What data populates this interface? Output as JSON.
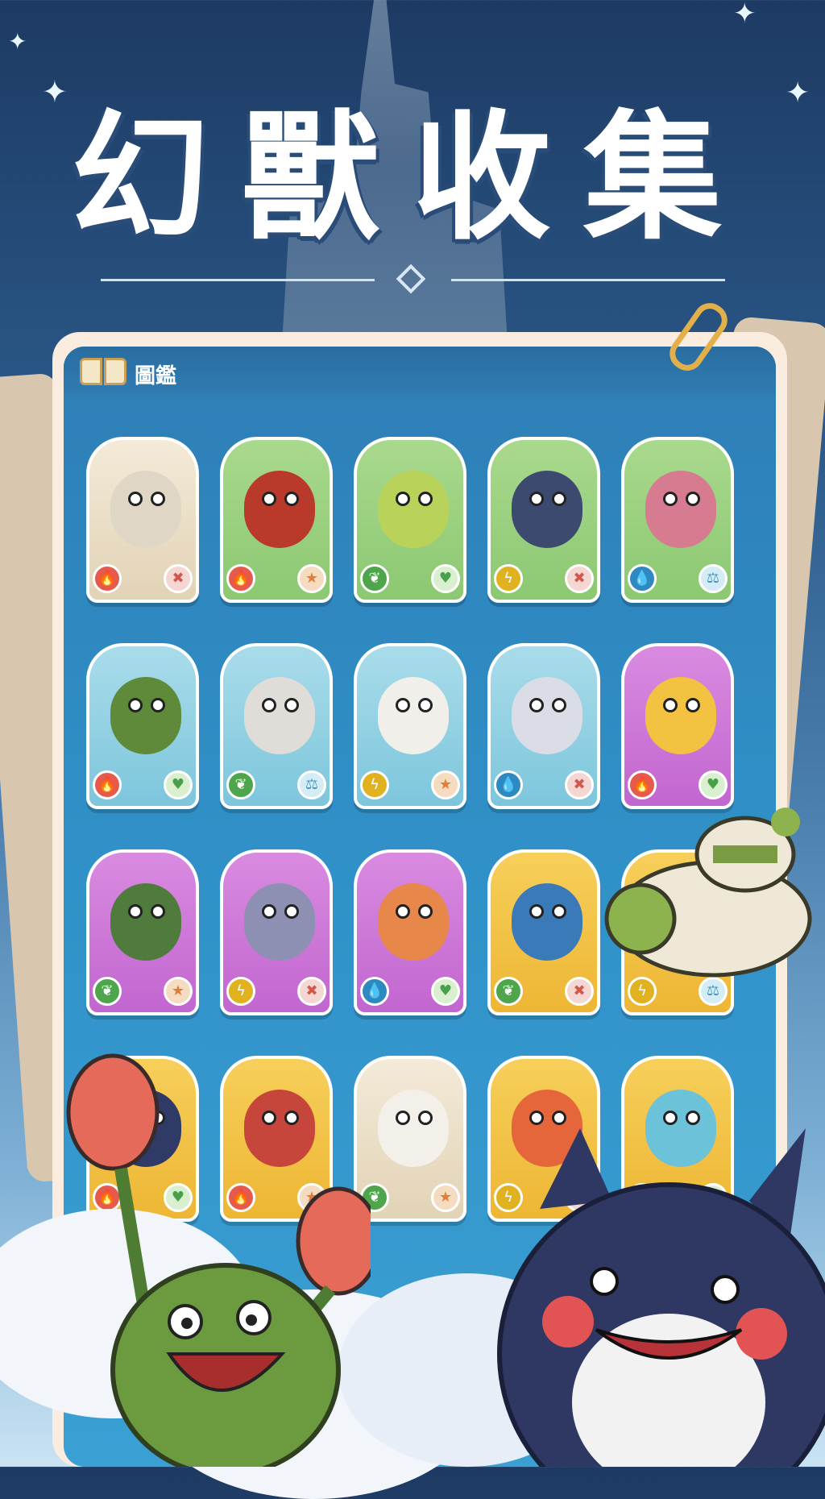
{
  "title": "幻獸收集",
  "panel": {
    "header_title": "圖鑑"
  },
  "cards": [
    {
      "bg": "cream",
      "creature_color": "#e0d6c6",
      "type_icon": "flame-icon",
      "type_glyph": "🔥",
      "type_class": "type-fire",
      "status_icon": "cross-icon",
      "status_glyph": "✖",
      "status_class": "st-cross"
    },
    {
      "bg": "green",
      "creature_color": "#b93a2a",
      "type_icon": "flame-icon",
      "type_glyph": "🔥",
      "type_class": "type-fire",
      "status_icon": "star-icon",
      "status_glyph": "★",
      "status_class": "st-star"
    },
    {
      "bg": "green",
      "creature_color": "#b9d35a",
      "type_icon": "leaf-icon",
      "type_glyph": "❦",
      "type_class": "type-leaf",
      "status_icon": "heart-icon",
      "status_glyph": "♥",
      "status_class": "st-heart"
    },
    {
      "bg": "green",
      "creature_color": "#3d4a70",
      "type_icon": "bolt-icon",
      "type_glyph": "ϟ",
      "type_class": "type-bolt",
      "status_icon": "cross-icon",
      "status_glyph": "✖",
      "status_class": "st-cross"
    },
    {
      "bg": "green",
      "creature_color": "#d77b90",
      "type_icon": "water-drop-icon",
      "type_glyph": "💧",
      "type_class": "type-water",
      "status_icon": "scale-icon",
      "status_glyph": "⚖",
      "status_class": "st-scale"
    },
    {
      "bg": "blue",
      "creature_color": "#5e8a3a",
      "type_icon": "flame-icon",
      "type_glyph": "🔥",
      "type_class": "type-fire",
      "status_icon": "heart-icon",
      "status_glyph": "♥",
      "status_class": "st-heart"
    },
    {
      "bg": "blue",
      "creature_color": "#e0ddd8",
      "type_icon": "leaf-icon",
      "type_glyph": "❦",
      "type_class": "type-leaf",
      "status_icon": "scale-icon",
      "status_glyph": "⚖",
      "status_class": "st-scale"
    },
    {
      "bg": "blue",
      "creature_color": "#f0efe9",
      "type_icon": "bolt-icon",
      "type_glyph": "ϟ",
      "type_class": "type-bolt",
      "status_icon": "star-icon",
      "status_glyph": "★",
      "status_class": "st-star"
    },
    {
      "bg": "blue",
      "creature_color": "#dadde6",
      "type_icon": "water-drop-icon",
      "type_glyph": "💧",
      "type_class": "type-water",
      "status_icon": "cross-icon",
      "status_glyph": "✖",
      "status_class": "st-cross"
    },
    {
      "bg": "purple",
      "creature_color": "#f2c240",
      "type_icon": "flame-icon",
      "type_glyph": "🔥",
      "type_class": "type-fire",
      "status_icon": "heart-icon",
      "status_glyph": "♥",
      "status_class": "st-heart"
    },
    {
      "bg": "purple",
      "creature_color": "#4f7b3c",
      "type_icon": "leaf-icon",
      "type_glyph": "❦",
      "type_class": "type-leaf",
      "status_icon": "star-icon",
      "status_glyph": "★",
      "status_class": "st-star"
    },
    {
      "bg": "purple",
      "creature_color": "#8d90b3",
      "type_icon": "bolt-icon",
      "type_glyph": "ϟ",
      "type_class": "type-bolt",
      "status_icon": "cross-icon",
      "status_glyph": "✖",
      "status_class": "st-cross"
    },
    {
      "bg": "purple",
      "creature_color": "#e7874a",
      "type_icon": "water-drop-icon",
      "type_glyph": "💧",
      "type_class": "type-water",
      "status_icon": "heart-icon",
      "status_glyph": "♥",
      "status_class": "st-heart"
    },
    {
      "bg": "yellow",
      "creature_color": "#3a7ab8",
      "type_icon": "leaf-icon",
      "type_glyph": "❦",
      "type_class": "type-leaf",
      "status_icon": "cross-icon",
      "status_glyph": "✖",
      "status_class": "st-cross"
    },
    {
      "bg": "yellow",
      "creature_color": "#efe6d2",
      "type_icon": "bolt-icon",
      "type_glyph": "ϟ",
      "type_class": "type-bolt",
      "status_icon": "scale-icon",
      "status_glyph": "⚖",
      "status_class": "st-scale"
    },
    {
      "bg": "yellow",
      "creature_color": "#2f3a66",
      "type_icon": "flame-icon",
      "type_glyph": "🔥",
      "type_class": "type-fire",
      "status_icon": "heart-icon",
      "status_glyph": "♥",
      "status_class": "st-heart"
    },
    {
      "bg": "yellow",
      "creature_color": "#c7463b",
      "type_icon": "flame-icon",
      "type_glyph": "🔥",
      "type_class": "type-fire",
      "status_icon": "star-icon",
      "status_glyph": "★",
      "status_class": "st-star"
    },
    {
      "bg": "cream",
      "creature_color": "#f2f0e8",
      "type_icon": "leaf-icon",
      "type_glyph": "❦",
      "type_class": "type-leaf",
      "status_icon": "star-icon",
      "status_glyph": "★",
      "status_class": "st-star"
    },
    {
      "bg": "yellow",
      "creature_color": "#e6663b",
      "type_icon": "bolt-icon",
      "type_glyph": "ϟ",
      "type_class": "type-bolt",
      "status_icon": "cross-icon",
      "status_glyph": "✖",
      "status_class": "st-cross"
    },
    {
      "bg": "yellow",
      "creature_color": "#6cc2d8",
      "type_icon": "water-drop-icon",
      "type_glyph": "💧",
      "type_class": "type-water",
      "status_icon": "heart-icon",
      "status_glyph": "♥",
      "status_class": "st-heart"
    }
  ]
}
